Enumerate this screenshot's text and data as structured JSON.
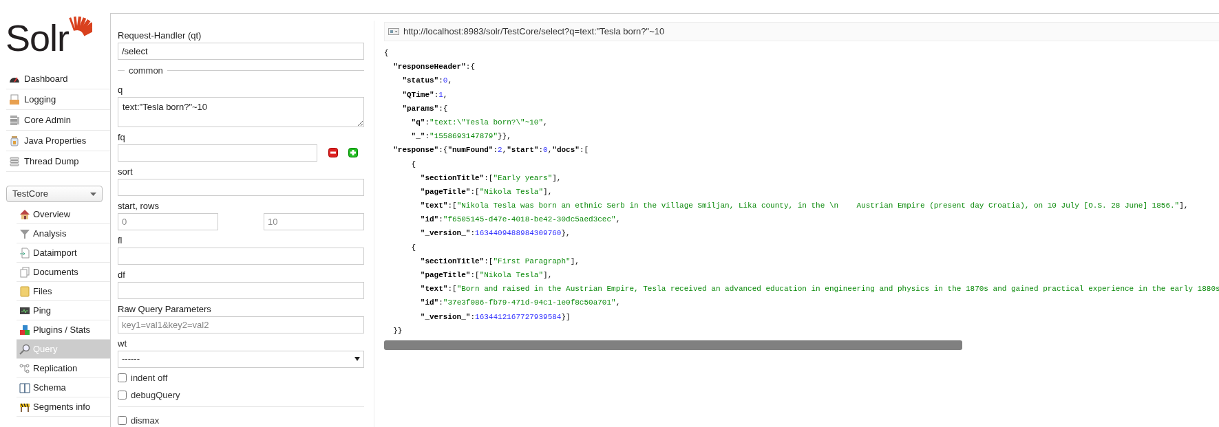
{
  "logo": {
    "text": "Solr"
  },
  "nav": [
    {
      "label": "Dashboard"
    },
    {
      "label": "Logging"
    },
    {
      "label": "Core Admin"
    },
    {
      "label": "Java Properties"
    },
    {
      "label": "Thread Dump"
    }
  ],
  "core_selector": {
    "value": "TestCore"
  },
  "core_menu": [
    {
      "label": "Overview",
      "selected": false
    },
    {
      "label": "Analysis",
      "selected": false
    },
    {
      "label": "Dataimport",
      "selected": false
    },
    {
      "label": "Documents",
      "selected": false
    },
    {
      "label": "Files",
      "selected": false
    },
    {
      "label": "Ping",
      "selected": false
    },
    {
      "label": "Plugins / Stats",
      "selected": false
    },
    {
      "label": "Query",
      "selected": true
    },
    {
      "label": "Replication",
      "selected": false
    },
    {
      "label": "Schema",
      "selected": false
    },
    {
      "label": "Segments info",
      "selected": false
    }
  ],
  "form": [
    {
      "kind": "text",
      "label": "Request-Handler (qt)",
      "value": "/select"
    },
    {
      "kind": "legend",
      "label": "common"
    },
    {
      "kind": "textarea",
      "label": "q",
      "value": "text:\"Tesla born?\"~10"
    },
    {
      "kind": "filter",
      "label": "fq"
    },
    {
      "kind": "text",
      "label": "sort"
    },
    {
      "kind": "pair",
      "label": "start, rows",
      "placeholders": [
        "0",
        "10"
      ]
    },
    {
      "kind": "text",
      "label": "fl"
    },
    {
      "kind": "text",
      "label": "df"
    },
    {
      "kind": "text",
      "label": "Raw Query Parameters",
      "placeholder": "key1=val1&key2=val2"
    },
    {
      "kind": "select",
      "label": "wt",
      "value": "------"
    },
    {
      "kind": "checkbox",
      "label": "indent off",
      "checked": false
    },
    {
      "kind": "checkbox",
      "label": "debugQuery",
      "checked": false
    },
    {
      "kind": "divider"
    },
    {
      "kind": "checkbox",
      "label": "dismax",
      "checked": false
    }
  ],
  "result": {
    "url": "http://localhost:8983/solr/TestCore/select?q=text:\"Tesla born?\"~10",
    "lines": [
      [
        {
          "kind": "punct",
          "text": "{"
        }
      ],
      [
        {
          "kind": "key",
          "text": "  \"responseHeader\""
        },
        {
          "kind": "punct",
          "text": ":{"
        }
      ],
      [
        {
          "kind": "key",
          "text": "    \"status\""
        },
        {
          "kind": "punct",
          "text": ":"
        },
        {
          "kind": "num",
          "text": "0"
        },
        {
          "kind": "punct",
          "text": ","
        }
      ],
      [
        {
          "kind": "key",
          "text": "    \"QTime\""
        },
        {
          "kind": "punct",
          "text": ":"
        },
        {
          "kind": "num",
          "text": "1"
        },
        {
          "kind": "punct",
          "text": ","
        }
      ],
      [
        {
          "kind": "key",
          "text": "    \"params\""
        },
        {
          "kind": "punct",
          "text": ":{"
        }
      ],
      [
        {
          "kind": "key",
          "text": "      \"q\""
        },
        {
          "kind": "punct",
          "text": ":"
        },
        {
          "kind": "str",
          "text": "\"text:\\\"Tesla born?\\\"~10\""
        },
        {
          "kind": "punct",
          "text": ","
        }
      ],
      [
        {
          "kind": "key",
          "text": "      \"_\""
        },
        {
          "kind": "punct",
          "text": ":"
        },
        {
          "kind": "str",
          "text": "\"1558693147879\""
        },
        {
          "kind": "punct",
          "text": "}},"
        }
      ],
      [
        {
          "kind": "key",
          "text": "  \"response\""
        },
        {
          "kind": "punct",
          "text": ":{"
        },
        {
          "kind": "key",
          "text": "\"numFound\""
        },
        {
          "kind": "punct",
          "text": ":"
        },
        {
          "kind": "num",
          "text": "2"
        },
        {
          "kind": "punct",
          "text": ","
        },
        {
          "kind": "key",
          "text": "\"start\""
        },
        {
          "kind": "punct",
          "text": ":"
        },
        {
          "kind": "num",
          "text": "0"
        },
        {
          "kind": "punct",
          "text": ","
        },
        {
          "kind": "key",
          "text": "\"docs\""
        },
        {
          "kind": "punct",
          "text": ":["
        }
      ],
      [
        {
          "kind": "punct",
          "text": "      {"
        }
      ],
      [
        {
          "kind": "key",
          "text": "        \"sectionTitle\""
        },
        {
          "kind": "punct",
          "text": ":["
        },
        {
          "kind": "str",
          "text": "\"Early years\""
        },
        {
          "kind": "punct",
          "text": "],"
        }
      ],
      [
        {
          "kind": "key",
          "text": "        \"pageTitle\""
        },
        {
          "kind": "punct",
          "text": ":["
        },
        {
          "kind": "str",
          "text": "\"Nikola Tesla\""
        },
        {
          "kind": "punct",
          "text": "],"
        }
      ],
      [
        {
          "kind": "key",
          "text": "        \"text\""
        },
        {
          "kind": "punct",
          "text": ":["
        },
        {
          "kind": "str",
          "text": "\"Nikola Tesla was born an ethnic Serb in the village Smiljan, Lika county, in the \\n    Austrian Empire (present day Croatia), on 10 July [O.S. 28 June] 1856.\""
        },
        {
          "kind": "punct",
          "text": "],"
        }
      ],
      [
        {
          "kind": "key",
          "text": "        \"id\""
        },
        {
          "kind": "punct",
          "text": ":"
        },
        {
          "kind": "str",
          "text": "\"f6505145-d47e-4018-be42-30dc5aed3cec\""
        },
        {
          "kind": "punct",
          "text": ","
        }
      ],
      [
        {
          "kind": "key",
          "text": "        \"_version_\""
        },
        {
          "kind": "punct",
          "text": ":"
        },
        {
          "kind": "num",
          "text": "1634409488984309760"
        },
        {
          "kind": "punct",
          "text": "},"
        }
      ],
      [
        {
          "kind": "punct",
          "text": "      {"
        }
      ],
      [
        {
          "kind": "key",
          "text": "        \"sectionTitle\""
        },
        {
          "kind": "punct",
          "text": ":["
        },
        {
          "kind": "str",
          "text": "\"First Paragraph\""
        },
        {
          "kind": "punct",
          "text": "],"
        }
      ],
      [
        {
          "kind": "key",
          "text": "        \"pageTitle\""
        },
        {
          "kind": "punct",
          "text": ":["
        },
        {
          "kind": "str",
          "text": "\"Nikola Tesla\""
        },
        {
          "kind": "punct",
          "text": "],"
        }
      ],
      [
        {
          "kind": "key",
          "text": "        \"text\""
        },
        {
          "kind": "punct",
          "text": ":["
        },
        {
          "kind": "str",
          "text": "\"Born and raised in the Austrian Empire, Tesla received an advanced education in engineering and physics in the 1870s and gained practical experience in the early 1880s"
        }
      ],
      [
        {
          "kind": "key",
          "text": "        \"id\""
        },
        {
          "kind": "punct",
          "text": ":"
        },
        {
          "kind": "str",
          "text": "\"37e3f086-fb79-471d-94c1-1e0f8c50a701\""
        },
        {
          "kind": "punct",
          "text": ","
        }
      ],
      [
        {
          "kind": "key",
          "text": "        \"_version_\""
        },
        {
          "kind": "punct",
          "text": ":"
        },
        {
          "kind": "num",
          "text": "1634412167727939584"
        },
        {
          "kind": "punct",
          "text": "}]"
        }
      ],
      [
        {
          "kind": "punct",
          "text": "  }}"
        }
      ]
    ]
  }
}
